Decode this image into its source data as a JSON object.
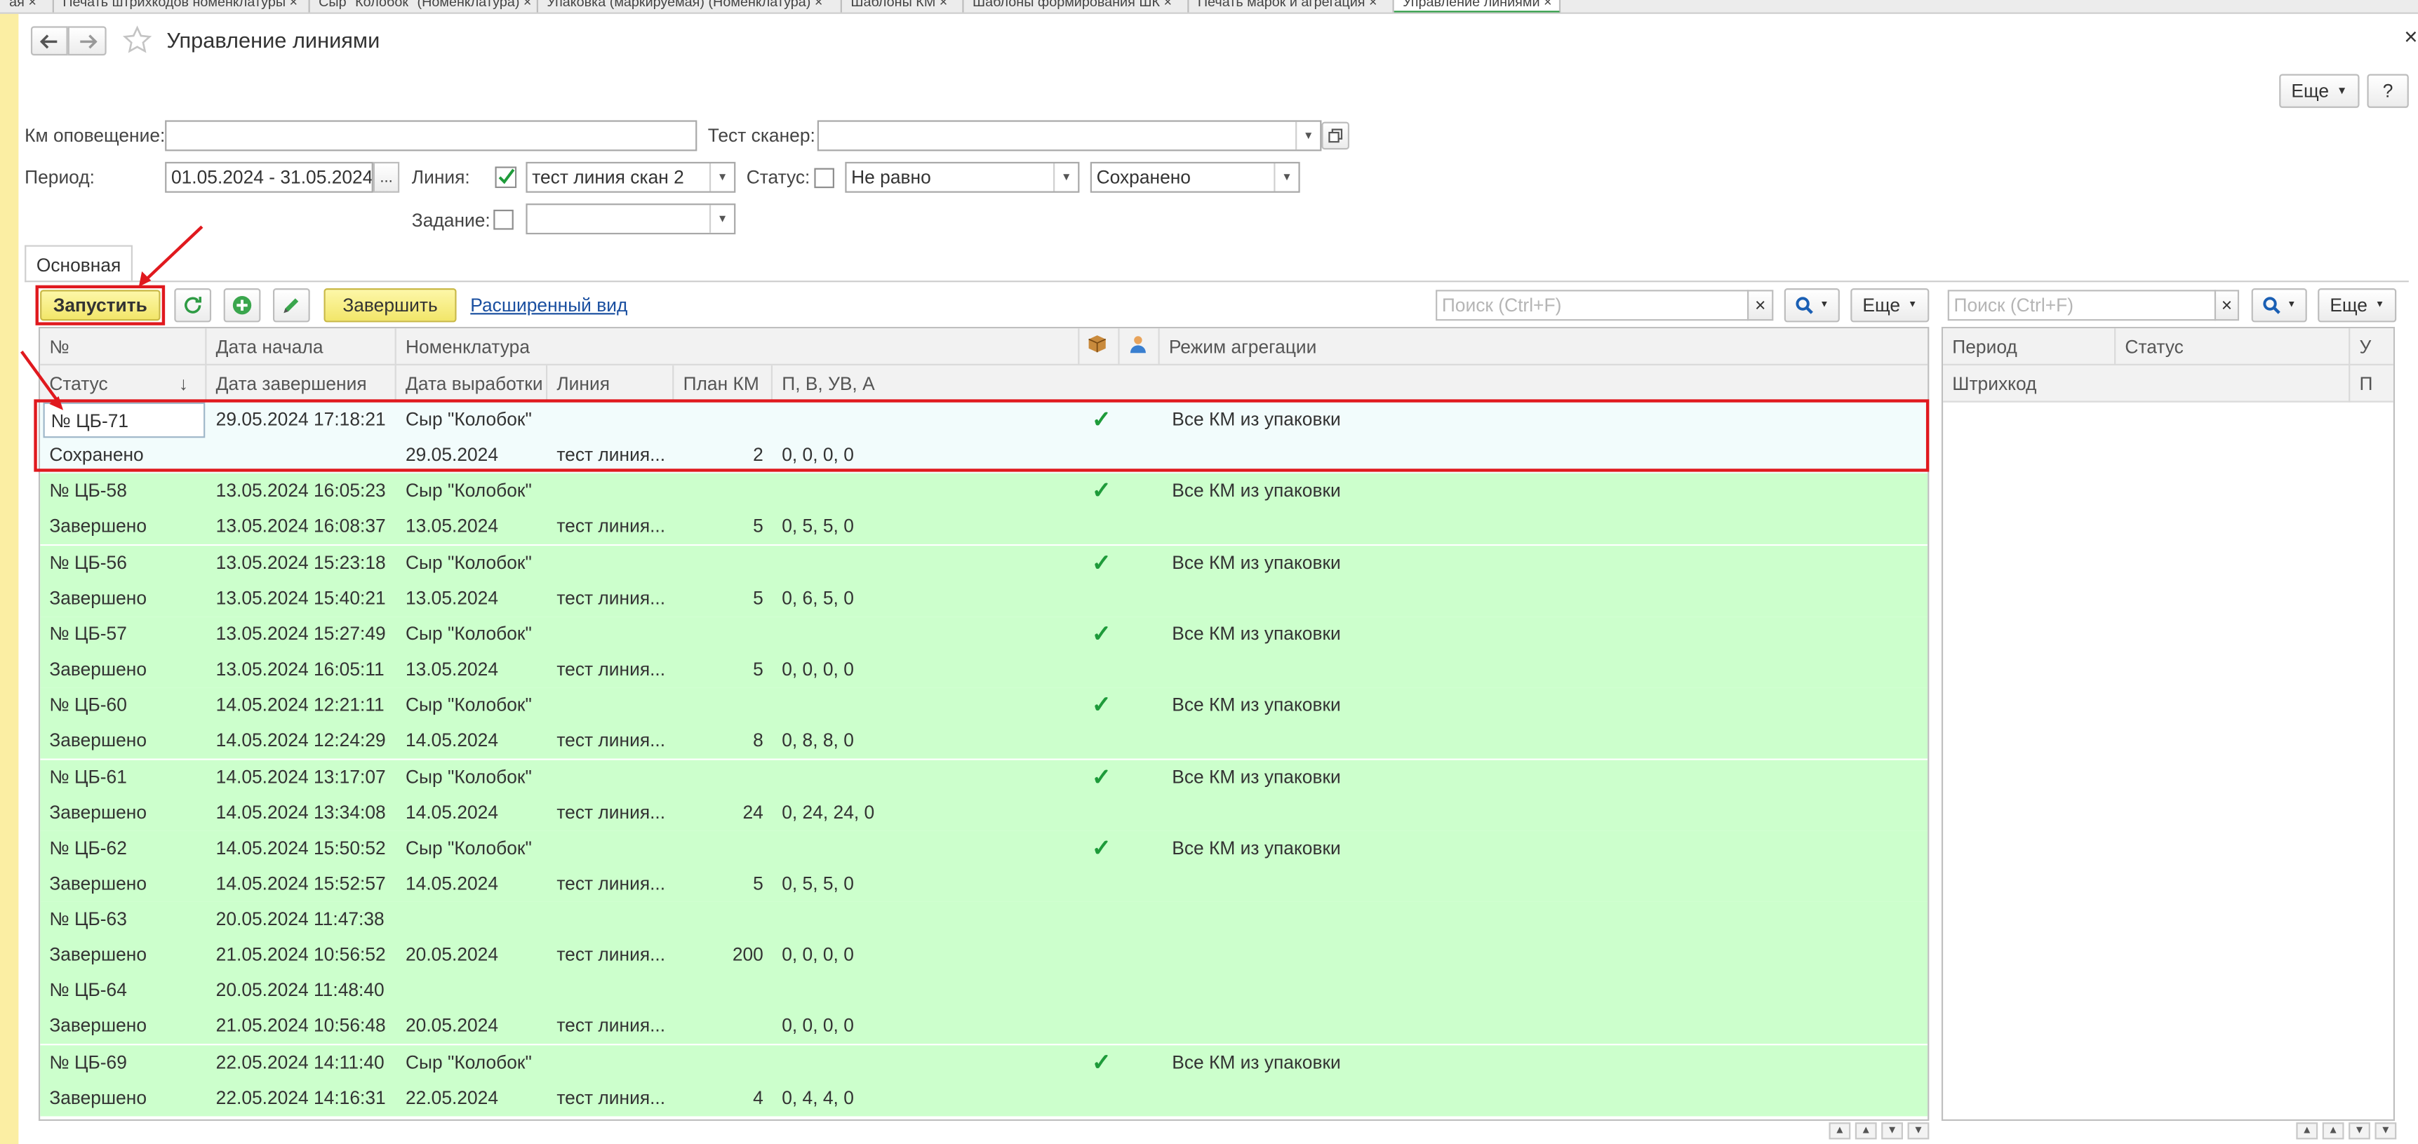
{
  "tabs": [
    {
      "label": "ая ×"
    },
    {
      "label": "Печать штрихкодов номенклатуры ×"
    },
    {
      "label": "Сыр \"Колобок\" (Номенклатура) ×"
    },
    {
      "label": "Упаковка (маркируемая) (Номенклатура) ×"
    },
    {
      "label": "Шаблоны КМ ×"
    },
    {
      "label": "Шаблоны формирования ШК ×"
    },
    {
      "label": "Печать марок и агрегация ×"
    },
    {
      "label": "Управление линиями ×"
    }
  ],
  "window": {
    "title": "Управление линиями",
    "close": "×",
    "more": "Еще",
    "help": "?"
  },
  "filters": {
    "km_label": "Км оповещение:",
    "km_value": "",
    "scanner_label": "Тест сканер:",
    "scanner_value": "",
    "period_label": "Период:",
    "period_value": "01.05.2024 - 31.05.2024",
    "period_btn": "...",
    "line_label": "Линия:",
    "line_checked": true,
    "line_value": "тест линия скан 2",
    "status_label": "Статус:",
    "status_checked": false,
    "status_cond": "Не равно",
    "status_value": "Сохранено",
    "task_label": "Задание:",
    "task_checked": false,
    "task_value": ""
  },
  "content_tab": "Основная",
  "toolbar": {
    "start": "Запустить",
    "finish": "Завершить",
    "extended": "Расширенный вид",
    "search_placeholder": "Поиск (Ctrl+F)",
    "search_clear": "×",
    "more": "Еще"
  },
  "grid": {
    "header1": {
      "num": "№",
      "start": "Дата начала",
      "nomen": "Номенклатура",
      "mode": "Режим агрегации"
    },
    "header2": {
      "status": "Статус",
      "sort": "↓",
      "end": "Дата завершения",
      "prod": "Дата выработки",
      "line": "Линия",
      "plan": "План КМ",
      "pvua": "П, В, УВ, А"
    },
    "rows": [
      {
        "num": "№ ЦБ-71",
        "start": "29.05.2024 17:18:21",
        "nomen": "Сыр \"Колобок\"",
        "check": "✓",
        "mode": "Все КМ из упаковки",
        "status": "Сохранено",
        "end": "",
        "prod": "29.05.2024",
        "line": "тест линия...",
        "plan": "2",
        "pvua": "0, 0, 0, 0"
      },
      {
        "num": "№ ЦБ-58",
        "start": "13.05.2024 16:05:23",
        "nomen": "Сыр \"Колобок\"",
        "check": "✓",
        "mode": "Все КМ из упаковки",
        "status": "Завершено",
        "end": "13.05.2024 16:08:37",
        "prod": "13.05.2024",
        "line": "тест линия...",
        "plan": "5",
        "pvua": "0, 5, 5, 0"
      },
      {
        "num": "№ ЦБ-56",
        "start": "13.05.2024 15:23:18",
        "nomen": "Сыр \"Колобок\"",
        "check": "✓",
        "mode": "Все КМ из упаковки",
        "status": "Завершено",
        "end": "13.05.2024 15:40:21",
        "prod": "13.05.2024",
        "line": "тест линия...",
        "plan": "5",
        "pvua": "0, 6, 5, 0"
      },
      {
        "num": "№ ЦБ-57",
        "start": "13.05.2024 15:27:49",
        "nomen": "Сыр \"Колобок\"",
        "check": "✓",
        "mode": "Все КМ из упаковки",
        "status": "Завершено",
        "end": "13.05.2024 16:05:11",
        "prod": "13.05.2024",
        "line": "тест линия...",
        "plan": "5",
        "pvua": "0, 0, 0, 0"
      },
      {
        "num": "№ ЦБ-60",
        "start": "14.05.2024 12:21:11",
        "nomen": "Сыр \"Колобок\"",
        "check": "✓",
        "mode": "Все КМ из упаковки",
        "status": "Завершено",
        "end": "14.05.2024 12:24:29",
        "prod": "14.05.2024",
        "line": "тест линия...",
        "plan": "8",
        "pvua": "0, 8, 8, 0"
      },
      {
        "num": "№ ЦБ-61",
        "start": "14.05.2024 13:17:07",
        "nomen": "Сыр \"Колобок\"",
        "check": "✓",
        "mode": "Все КМ из упаковки",
        "status": "Завершено",
        "end": "14.05.2024 13:34:08",
        "prod": "14.05.2024",
        "line": "тест линия...",
        "plan": "24",
        "pvua": "0, 24, 24, 0"
      },
      {
        "num": "№ ЦБ-62",
        "start": "14.05.2024 15:50:52",
        "nomen": "Сыр \"Колобок\"",
        "check": "✓",
        "mode": "Все КМ из упаковки",
        "status": "Завершено",
        "end": "14.05.2024 15:52:57",
        "prod": "14.05.2024",
        "line": "тест линия...",
        "plan": "5",
        "pvua": "0, 5, 5, 0"
      },
      {
        "num": "№ ЦБ-63",
        "start": "20.05.2024 11:47:38",
        "nomen": "",
        "check": "",
        "mode": "",
        "status": "Завершено",
        "end": "21.05.2024 10:56:52",
        "prod": "20.05.2024",
        "line": "тест линия...",
        "plan": "200",
        "pvua": "0, 0, 0, 0"
      },
      {
        "num": "№ ЦБ-64",
        "start": "20.05.2024 11:48:40",
        "nomen": "",
        "check": "",
        "mode": "",
        "status": "Завершено",
        "end": "21.05.2024 10:56:48",
        "prod": "20.05.2024",
        "line": "тест линия...",
        "plan": "",
        "pvua": "0, 0, 0, 0"
      },
      {
        "num": "№ ЦБ-69",
        "start": "22.05.2024 14:11:40",
        "nomen": "Сыр \"Колобок\"",
        "check": "✓",
        "mode": "Все КМ из упаковки",
        "status": "Завершено",
        "end": "22.05.2024 14:16:31",
        "prod": "22.05.2024",
        "line": "тест линия...",
        "plan": "4",
        "pvua": "0, 4, 4, 0"
      }
    ]
  },
  "right_grid": {
    "period": "Период",
    "status": "Статус",
    "u": "У",
    "barcode": "Штрихкод",
    "p": "П"
  },
  "colors": {
    "row_green": "#ccffcc",
    "selected_row": "#f2fcfc",
    "highlight_red": "#e0191e",
    "start_button": "#f4e87a",
    "check_green": "#1e9b3a"
  },
  "icons": [
    "back-arrow-icon",
    "forward-arrow-icon",
    "star-icon",
    "refresh-icon",
    "add-icon",
    "edit-icon",
    "search-icon",
    "package-icon",
    "user-icon"
  ]
}
